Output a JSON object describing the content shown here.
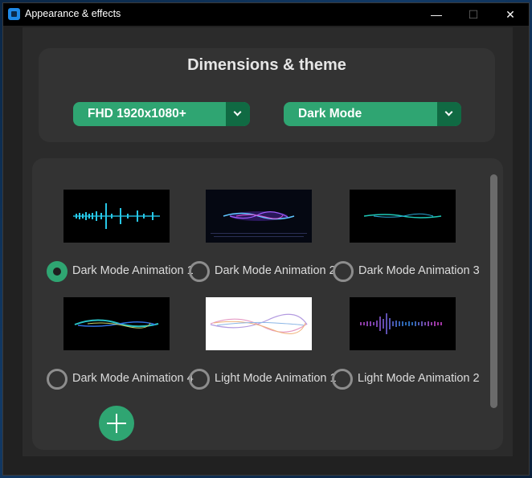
{
  "window": {
    "title": "Appearance & effects",
    "minimize_symbol": "—",
    "maximize_symbol": "☐",
    "close_symbol": "✕"
  },
  "header": {
    "heading": "Dimensions & theme"
  },
  "dropdowns": {
    "resolution": {
      "selected": "FHD 1920x1080+"
    },
    "theme": {
      "selected": "Dark Mode"
    }
  },
  "animations": [
    {
      "label": "Dark Mode Animation 1",
      "selected": true
    },
    {
      "label": "Dark Mode Animation 2",
      "selected": false
    },
    {
      "label": "Dark Mode Animation 3",
      "selected": false
    },
    {
      "label": "Dark Mode Animation 4",
      "selected": false
    },
    {
      "label": "Light Mode Animation 1",
      "selected": false
    },
    {
      "label": "Light Mode Animation 2",
      "selected": false
    }
  ],
  "colors": {
    "accent": "#2fa572",
    "accent_dark": "#106a43"
  }
}
